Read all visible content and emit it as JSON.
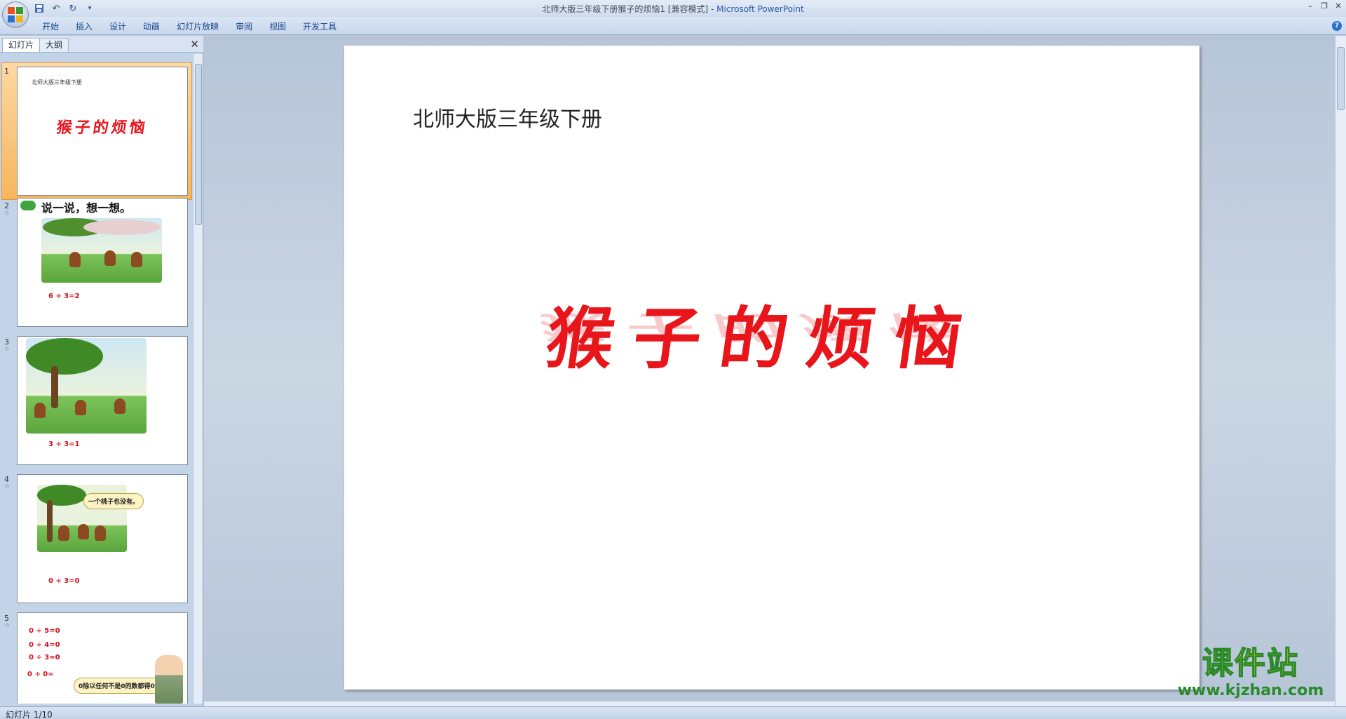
{
  "window": {
    "title": "北师大版三年级下册猴子的烦恼1 [兼容模式]",
    "app_name": "Microsoft PowerPoint"
  },
  "quick_access": [
    "save-icon",
    "undo-icon",
    "redo-icon",
    "customize-icon"
  ],
  "ribbon": {
    "tabs": [
      "开始",
      "插入",
      "设计",
      "动画",
      "幻灯片放映",
      "审阅",
      "视图",
      "开发工具"
    ]
  },
  "pane": {
    "tab_slides": "幻灯片",
    "tab_outline": "大纲",
    "close": "✕"
  },
  "thumbnails": [
    {
      "num": "1",
      "subtitle": "北师大版三年级下册",
      "title": "猴子的烦恼"
    },
    {
      "num": "2",
      "heading": "说一说，想一想。",
      "equation": "6 ÷ 3=2"
    },
    {
      "num": "3",
      "equation": "3 ÷ 3=1"
    },
    {
      "num": "4",
      "bubble": "一个桃子也没有。",
      "equation": "0 ÷ 3=0"
    },
    {
      "num": "5",
      "lines": [
        "0 ÷ 5=0",
        "0 ÷ 4=0",
        "0 ÷ 3=0",
        "0 ÷ 0="
      ],
      "bubble": "0除以任何不是0的数都得0。"
    }
  ],
  "slide": {
    "subtitle": "北师大版三年级下册",
    "title": "猴子的烦恼"
  },
  "status": {
    "slide_indicator": "幻灯片 1/10"
  },
  "watermark": {
    "main": "课件站",
    "url": "www.kjzhan.com"
  },
  "colors": {
    "title_red": "#e8151b",
    "ribbon_bg": "#dbe6f4",
    "selected_thumb": "#f6b65d"
  }
}
